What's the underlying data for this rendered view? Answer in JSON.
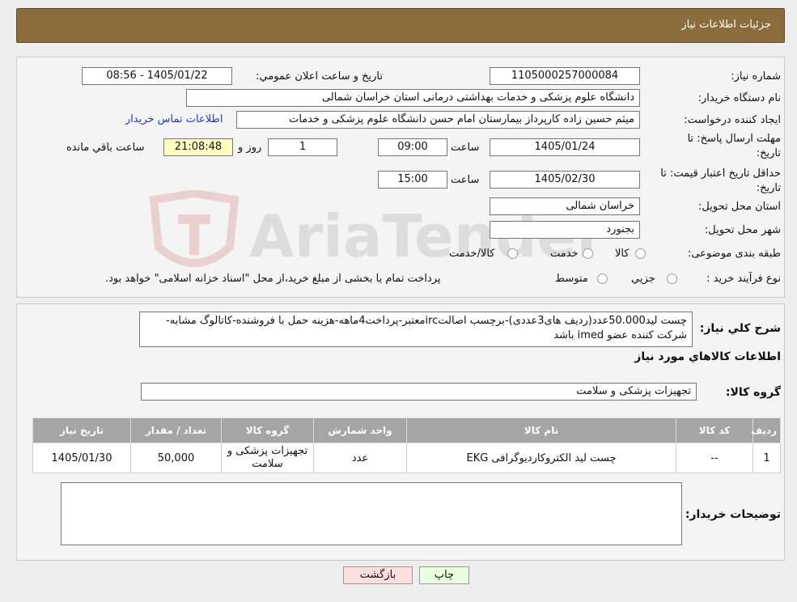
{
  "header": {
    "title": "جزئیات اطلاعات نیاز"
  },
  "fields": {
    "need_number_label": "شماره نیاز:",
    "need_number": "1105000257000084",
    "announce_label": "تاریخ و ساعت اعلان عمومي:",
    "announce_value": "1405/01/22 - 08:56",
    "buyer_org_label": "نام دستگاه خريدار:",
    "buyer_org": "دانشگاه علوم پزشکی و خدمات بهداشتی درمانی استان خراسان شمالی",
    "requester_label": "ايجاد کننده درخواست:",
    "requester": "میثم  حسین زاده  کارپرداز بیمارستان امام حسن دانشگاه علوم پزشکی و خدمات",
    "contact_link": "اطلاعات تماس خريدار",
    "deadline_label_1": "مهلت ارسال پاسخ: تا",
    "deadline_label_2": "تاريخ:",
    "deadline_date": "1405/01/24",
    "time_label": "ساعت",
    "deadline_time": "09:00",
    "days_value": "1",
    "days_label": "روز و",
    "remaining_time": "21:08:48",
    "remaining_label": "ساعت باقي مانده",
    "validity_label_1": "حداقل تاريخ اعتبار قيمت: تا",
    "validity_label_2": "تاريخ:",
    "validity_date": "1405/02/30",
    "validity_time": "15:00",
    "province_label": "استان محل تحويل:",
    "province": "خراسان شمالی",
    "city_label": "شهر محل تحويل:",
    "city": "بجنورد",
    "category_label": "طبقه بندی موضوعی:",
    "category_options": [
      "كالا",
      "خدمت",
      "كالا/خدمت"
    ],
    "process_label": "نوع فرآيند خريد :",
    "process_options": [
      "جزيي",
      "متوسط"
    ],
    "process_note": "پرداخت تمام یا بخشی از مبلغ خرید،از محل \"اسناد خزانه اسلامی\" خواهد بود."
  },
  "description": {
    "label": "شرح كلي نياز:",
    "text": "چست لید50.000عدد(ردیف های3عددی)-برچسب اصالتircمعتبر-پرداخت4ماهه-هزینه حمل با فروشنده-کاتالوگ مشابه-شرکت کننده عضو imed باشد"
  },
  "items": {
    "section_title": "اطلاعات كالاهاي مورد نياز",
    "group_label": "گروه كالا:",
    "group_value": "تجهیزات پزشکی و سلامت",
    "columns": [
      "رديف",
      "کد كالا",
      "نام كالا",
      "واحد شمارش",
      "گروه كالا",
      "تعداد / مقدار",
      "تاريخ نياز"
    ],
    "rows": [
      [
        "1",
        "--",
        "چست لید الکتروکاردیوگرافی EKG",
        "عدد",
        "تجهیزات پزشکی و سلامت",
        "50,000",
        "1405/01/30"
      ]
    ]
  },
  "buyer_notes": {
    "label": "توضيحات خريدار:",
    "value": ""
  },
  "buttons": {
    "print": "چاپ",
    "back": "بازگشت"
  },
  "watermark_text": "AriaTender.neT"
}
